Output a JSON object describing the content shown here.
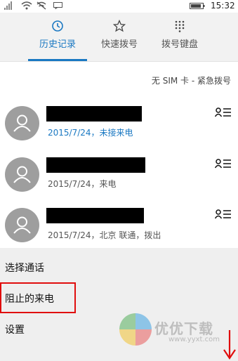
{
  "status_bar": {
    "time": "15:32"
  },
  "tabs": [
    {
      "label": "历史记录",
      "icon": "history-icon",
      "active": true
    },
    {
      "label": "快速拨号",
      "icon": "star-icon",
      "active": false
    },
    {
      "label": "拨号键盘",
      "icon": "dialpad-icon",
      "active": false
    }
  ],
  "sim_status": "无 SIM 卡 - 紧急拨号",
  "calls": [
    {
      "meta": "2015/7/24，未接来电",
      "missed": true
    },
    {
      "meta": "2015/7/24，来电",
      "missed": false
    },
    {
      "meta": "2015/7/24，北京 联通，拨出",
      "missed": false
    }
  ],
  "menu": {
    "select_calls": "选择通话",
    "blocked_calls": "阻止的来电",
    "settings": "设置"
  },
  "watermark": {
    "text": "优优下载",
    "url": "www.yyxt.com"
  },
  "colors": {
    "accent": "#1a78c2",
    "highlight_box": "#e00d0d",
    "avatar": "#9e9e9e"
  }
}
